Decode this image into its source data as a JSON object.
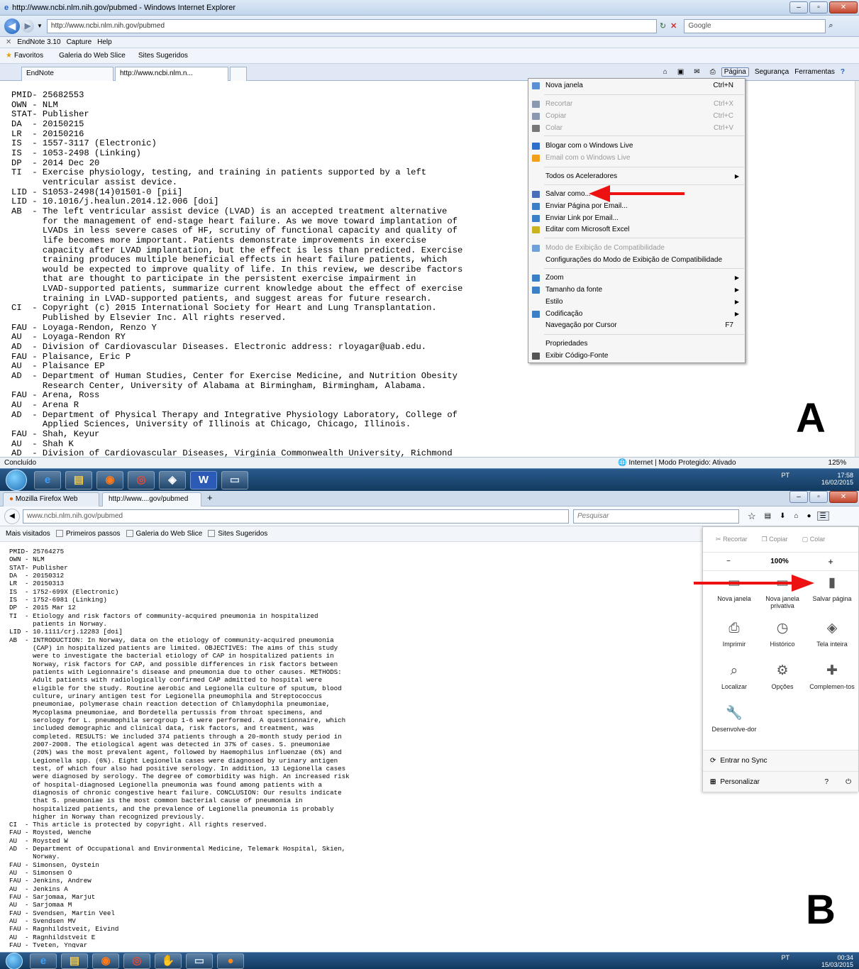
{
  "panel_a": {
    "title_bar": "http://www.ncbi.nlm.nih.gov/pubmed - Windows Internet Explorer",
    "address": "http://www.ncbi.nlm.nih.gov/pubmed",
    "search_placeholder": "Google",
    "toolbar": [
      "EndNote 3.10",
      "Capture",
      "Help"
    ],
    "favorites_label": "Favoritos",
    "favorites_items": [
      "Galeria do Web Slice",
      "Sites Sugeridos"
    ],
    "tabs": [
      "EndNote",
      "http://www.ncbi.nlm.n..."
    ],
    "command_bar": [
      "Página",
      "Segurança",
      "Ferramentas"
    ],
    "status_left": "Concluído",
    "status_zone": "Internet | Modo Protegido: Ativado",
    "zoom": "125%",
    "letter": "A",
    "content": "PMID- 25682553\nOWN - NLM\nSTAT- Publisher\nDA  - 20150215\nLR  - 20150216\nIS  - 1557-3117 (Electronic)\nIS  - 1053-2498 (Linking)\nDP  - 2014 Dec 20\nTI  - Exercise physiology, testing, and training in patients supported by a left\n      ventricular assist device.\nLID - S1053-2498(14)01501-0 [pii]\nLID - 10.1016/j.healun.2014.12.006 [doi]\nAB  - The left ventricular assist device (LVAD) is an accepted treatment alternative\n      for the management of end-stage heart failure. As we move toward implantation of\n      LVADs in less severe cases of HF, scrutiny of functional capacity and quality of\n      life becomes more important. Patients demonstrate improvements in exercise\n      capacity after LVAD implantation, but the effect is less than predicted. Exercise\n      training produces multiple beneficial effects in heart failure patients, which\n      would be expected to improve quality of life. In this review, we describe factors\n      that are thought to participate in the persistent exercise impairment in\n      LVAD-supported patients, summarize current knowledge about the effect of exercise\n      training in LVAD-supported patients, and suggest areas for future research.\nCI  - Copyright (c) 2015 International Society for Heart and Lung Transplantation.\n      Published by Elsevier Inc. All rights reserved.\nFAU - Loyaga-Rendon, Renzo Y\nAU  - Loyaga-Rendon RY\nAD  - Division of Cardiovascular Diseases. Electronic address: rloyagar@uab.edu.\nFAU - Plaisance, Eric P\nAU  - Plaisance EP\nAD  - Department of Human Studies, Center for Exercise Medicine, and Nutrition Obesity\n      Research Center, University of Alabama at Birmingham, Birmingham, Alabama.\nFAU - Arena, Ross\nAU  - Arena R\nAD  - Department of Physical Therapy and Integrative Physiology Laboratory, College of\n      Applied Sciences, University of Illinois at Chicago, Chicago, Illinois.\nFAU - Shah, Keyur\nAU  - Shah K\nAD  - Division of Cardiovascular Diseases, Virginia Commonwealth University, Richmond",
    "menu": [
      {
        "label": "Nova janela",
        "shortcut": "Ctrl+N",
        "disabled": false,
        "sub": false
      },
      {
        "label": "Recortar",
        "shortcut": "Ctrl+X",
        "disabled": true,
        "sub": false
      },
      {
        "label": "Copiar",
        "shortcut": "Ctrl+C",
        "disabled": true,
        "sub": false
      },
      {
        "label": "Colar",
        "shortcut": "Ctrl+V",
        "disabled": true,
        "sub": false
      },
      {
        "label": "Blogar com o Windows Live",
        "shortcut": "",
        "disabled": false,
        "sub": false
      },
      {
        "label": "Email com o Windows Live",
        "shortcut": "",
        "disabled": true,
        "sub": false
      },
      {
        "label": "Todos os Aceleradores",
        "shortcut": "",
        "disabled": false,
        "sub": true
      },
      {
        "label": "Salvar como...",
        "shortcut": "",
        "disabled": false,
        "sub": false
      },
      {
        "label": "Enviar Página por Email...",
        "shortcut": "",
        "disabled": false,
        "sub": false
      },
      {
        "label": "Enviar Link por Email...",
        "shortcut": "",
        "disabled": false,
        "sub": false
      },
      {
        "label": "Editar com Microsoft Excel",
        "shortcut": "",
        "disabled": false,
        "sub": false
      },
      {
        "label": "Modo de Exibição de Compatibilidade",
        "shortcut": "",
        "disabled": true,
        "sub": false
      },
      {
        "label": "Configurações do Modo de Exibição de Compatibilidade",
        "shortcut": "",
        "disabled": false,
        "sub": false
      },
      {
        "label": "Zoom",
        "shortcut": "",
        "disabled": false,
        "sub": true
      },
      {
        "label": "Tamanho da fonte",
        "shortcut": "",
        "disabled": false,
        "sub": true
      },
      {
        "label": "Estilo",
        "shortcut": "",
        "disabled": false,
        "sub": true
      },
      {
        "label": "Codificação",
        "shortcut": "",
        "disabled": false,
        "sub": true
      },
      {
        "label": "Navegação por Cursor",
        "shortcut": "F7",
        "disabled": false,
        "sub": false
      },
      {
        "label": "Propriedades",
        "shortcut": "",
        "disabled": false,
        "sub": false
      },
      {
        "label": "Exibir Código-Fonte",
        "shortcut": "",
        "disabled": false,
        "sub": false
      }
    ],
    "taskbar_tray": {
      "lang": "PT",
      "time": "17:58",
      "date": "16/02/2015"
    }
  },
  "panel_b": {
    "tabs": [
      "Mozilla Firefox Web Brows...",
      "http://www....gov/pubmed"
    ],
    "address": "www.ncbi.nlm.nih.gov/pubmed",
    "search_placeholder": "Pesquisar",
    "bookmarks": [
      "Mais visitados",
      "Primeiros passos",
      "Galeria do Web Slice",
      "Sites Sugeridos"
    ],
    "letter": "B",
    "content": "PMID- 25764275\nOWN - NLM\nSTAT- Publisher\nDA  - 20150312\nLR  - 20150313\nIS  - 1752-699X (Electronic)\nIS  - 1752-6981 (Linking)\nDP  - 2015 Mar 12\nTI  - Etiology and risk factors of community-acquired pneumonia in hospitalized\n      patients in Norway.\nLID - 10.1111/crj.12283 [doi]\nAB  - INTRODUCTION: In Norway, data on the etiology of community-acquired pneumonia\n      (CAP) in hospitalized patients are limited. OBJECTIVES: The aims of this study\n      were to investigate the bacterial etiology of CAP in hospitalized patients in\n      Norway, risk factors for CAP, and possible differences in risk factors between\n      patients with Legionnaire's disease and pneumonia due to other causes. METHODS:\n      Adult patients with radiologically confirmed CAP admitted to hospital were\n      eligible for the study. Routine aerobic and Legionella culture of sputum, blood\n      culture, urinary antigen test for Legionella pneumophila and Streptococcus\n      pneumoniae, polymerase chain reaction detection of Chlamydophila pneumoniae,\n      Mycoplasma pneumoniae, and Bordetella pertussis from throat specimens, and\n      serology for L. pneumophila serogroup 1-6 were performed. A questionnaire, which\n      included demographic and clinical data, risk factors, and treatment, was\n      completed. RESULTS: We included 374 patients through a 20-month study period in\n      2007-2008. The etiological agent was detected in 37% of cases. S. pneumoniae\n      (20%) was the most prevalent agent, followed by Haemophilus influenzae (6%) and\n      Legionella spp. (6%). Eight Legionella cases were diagnosed by urinary antigen\n      test, of which four also had positive serology. In addition, 13 Legionella cases\n      were diagnosed by serology. The degree of comorbidity was high. An increased risk\n      of hospital-diagnosed Legionella pneumonia was found among patients with a\n      diagnosis of chronic congestive heart failure. CONCLUSION: Our results indicate\n      that S. pneumoniae is the most common bacterial cause of pneumonia in\n      hospitalized patients, and the prevalence of Legionella pneumonia is probably\n      higher in Norway than recognized previously.\nCI  - This article is protected by copyright. All rights reserved.\nFAU - Roysted, Wenche\nAU  - Roysted W\nAD  - Department of Occupational and Environmental Medicine, Telemark Hospital, Skien,\n      Norway.\nFAU - Simonsen, Oystein\nAU  - Simonsen O\nFAU - Jenkins, Andrew\nAU  - Jenkins A\nFAU - Sarjomaa, Marjut\nAU  - Sarjomaa M\nFAU - Svendsen, Martin Veel\nAU  - Svendsen MV\nFAU - Ragnhildstveit, Eivind\nAU  - Ragnhildstveit E\nFAU - Tveten, Yngvar",
    "menu": {
      "edit": [
        "Recortar",
        "Copiar",
        "Colar"
      ],
      "zoom": "100%",
      "grid": [
        "Nova janela",
        "Nova janela privativa",
        "Salvar página",
        "Imprimir",
        "Histórico",
        "Tela inteira",
        "Localizar",
        "Opções",
        "Complemen-tos",
        "Desenvolve-dor"
      ],
      "sync": "Entrar no Sync",
      "customize": "Personalizar"
    },
    "taskbar_tray": {
      "lang": "PT",
      "time": "00:34",
      "date": "15/03/2015"
    }
  },
  "colors": {
    "arrow": "#ee1111",
    "ie_chrome": "#d3e1f2",
    "taskbar": "#1c4a78"
  }
}
